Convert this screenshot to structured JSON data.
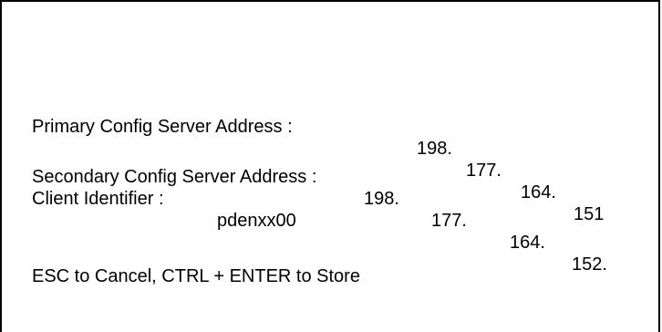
{
  "primary": {
    "label": "Primary Config Server Address :",
    "octets": [
      "198.",
      "177.",
      "164.",
      "151"
    ]
  },
  "secondary": {
    "label": "Secondary Config Server Address :",
    "octets": [
      "198.",
      "177.",
      "164.",
      "152."
    ]
  },
  "client": {
    "label": "Client Identifier :",
    "value": "pdenxx00"
  },
  "hint": "ESC to Cancel, CTRL + ENTER to Store"
}
